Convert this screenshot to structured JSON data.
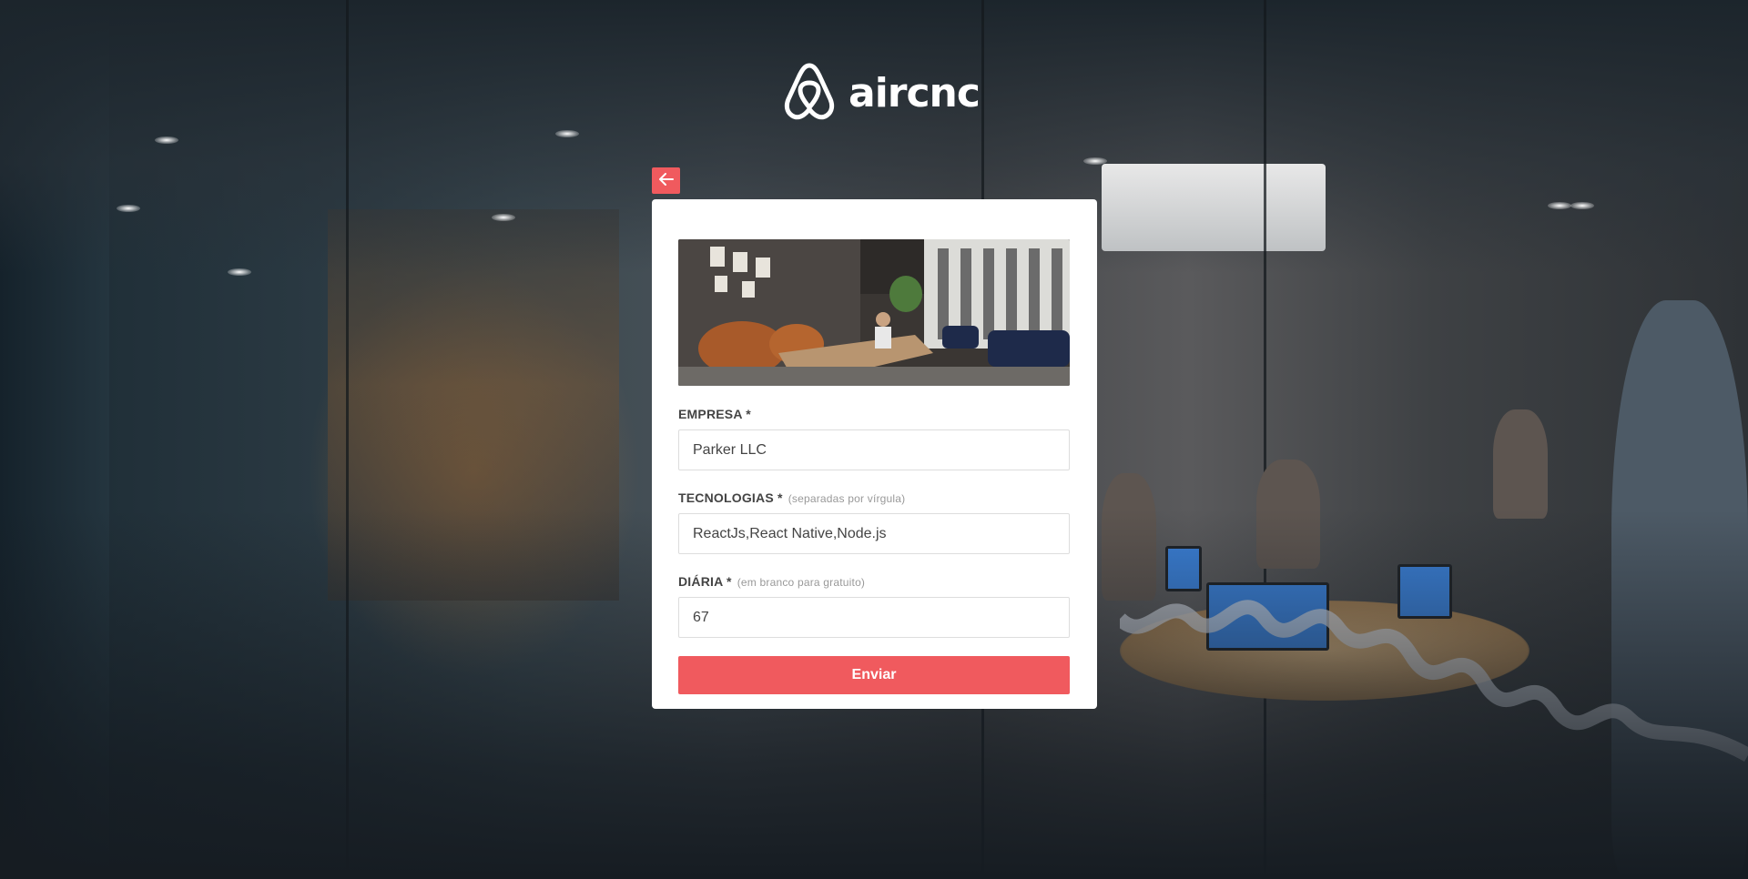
{
  "app": {
    "logo_text": "aircnc"
  },
  "colors": {
    "accent": "#f05a5e",
    "card_background": "#ffffff",
    "label": "#444444",
    "hint": "#999999"
  },
  "form": {
    "company": {
      "label": "EMPRESA *",
      "value": "Parker LLC"
    },
    "techs": {
      "label": "TECNOLOGIAS *",
      "hint": "(separadas por vírgula)",
      "value": "ReactJs,React Native,Node.js"
    },
    "price": {
      "label": "DIÁRIA *",
      "hint": "(em branco para gratuito)",
      "value": "67"
    },
    "submit_label": "Enviar"
  },
  "icons": {
    "back": "arrow-left-icon",
    "logo": "airbnb-belo-icon"
  }
}
